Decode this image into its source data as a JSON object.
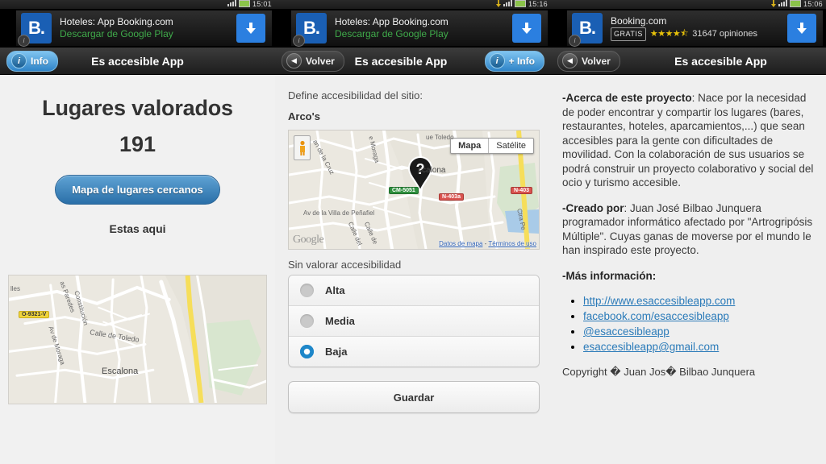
{
  "statusbar": {
    "time_p1": "15:01",
    "time_p2": "15:16",
    "time_p3": "15:06"
  },
  "ad_banner": {
    "logo_text": "B.",
    "info_badge": "i",
    "panel1": {
      "title": "Hoteles: App Booking.com",
      "subtitle": "Descargar de Google Play"
    },
    "panel2": {
      "title": "Hoteles: App Booking.com",
      "subtitle": "Descargar de Google Play"
    },
    "panel3": {
      "title": "Booking.com",
      "price_badge": "GRATIS",
      "stars": "★★★★⯪",
      "reviews": "31647 opiniones"
    },
    "download_icon": "download-arrow-icon"
  },
  "titlebar": {
    "app_title": "Es accesible App",
    "info_label": "Info",
    "plus_info_label": "+ Info",
    "back_label": "Volver",
    "info_icon": "i",
    "back_icon": "◀"
  },
  "panel1": {
    "heading": "Lugares valorados",
    "count": "191",
    "nearby_button": "Mapa de lugares cercanos",
    "here_label": "Estas aqui",
    "map_labels": {
      "road_shield": "O-9321-V",
      "street1": "Constitución",
      "street2": "as Paredes",
      "street3": "Av de Moraga",
      "street4": "Calle de Toledo",
      "town": "Escalona",
      "edge": "lles"
    }
  },
  "panel2": {
    "define_label": "Define accesibilidad del sitio:",
    "place_name": "Arco's",
    "map_toggle": {
      "map": "Mapa",
      "satellite": "Satélite",
      "selected": "Mapa"
    },
    "map_labels": {
      "street1": "an de la Cruz",
      "street2": "e Moraga",
      "street3": "ue Toledo",
      "street4": "Av de la Villa de Peñafiel",
      "street5": "Calle del",
      "street6": "Calle de",
      "street7": "Ctra Pe",
      "town": "scalona",
      "shield_cm": "CM-5051",
      "shield_n403a": "N-403a",
      "shield_n403": "N-403",
      "google_logo": "Google",
      "attribution_data": "Datos de mapa",
      "attribution_sep": "-",
      "attribution_terms": "Términos de uso",
      "marker_icon": "question-mark-map-marker",
      "pegman_icon": "street-view-pegman-icon"
    },
    "rating_label": "Sin valorar accesibilidad",
    "options": [
      {
        "label": "Alta",
        "selected": false
      },
      {
        "label": "Media",
        "selected": false
      },
      {
        "label": "Baja",
        "selected": true
      }
    ],
    "save_button": "Guardar"
  },
  "panel3": {
    "about_title": "-Acerca de este proyecto",
    "about_text": ": Nace por la necesidad de poder encontrar y compartir los lugares (bares, restaurantes, hoteles, aparcamientos,...) que sean accesibles para la gente con dificultades de movilidad. Con la colaboración de sus usuarios se podrá construir un proyecto colaborativo y social del ocio y turismo accesible.",
    "author_title": "-Creado por",
    "author_text": ": Juan José Bilbao Junquera programador informático afectado por \"Artrogripósis Múltiple\". Cuyas ganas de moverse por el mundo le han inspirado este proyecto.",
    "more_info_title": "-Más información:",
    "links": [
      "http://www.esaccesibleapp.com",
      "facebook.com/esaccesibleapp",
      "@esaccesibleapp",
      "esaccesibleapp@gmail.com"
    ],
    "copyright": "Copyright � Juan Jos� Bilbao Junquera"
  },
  "colors": {
    "accent_blue": "#2b7fe0",
    "link_blue": "#2b7bb9",
    "play_green": "#3faa4a",
    "star_gold": "#e8c20a",
    "page_bg": "#efefef"
  }
}
